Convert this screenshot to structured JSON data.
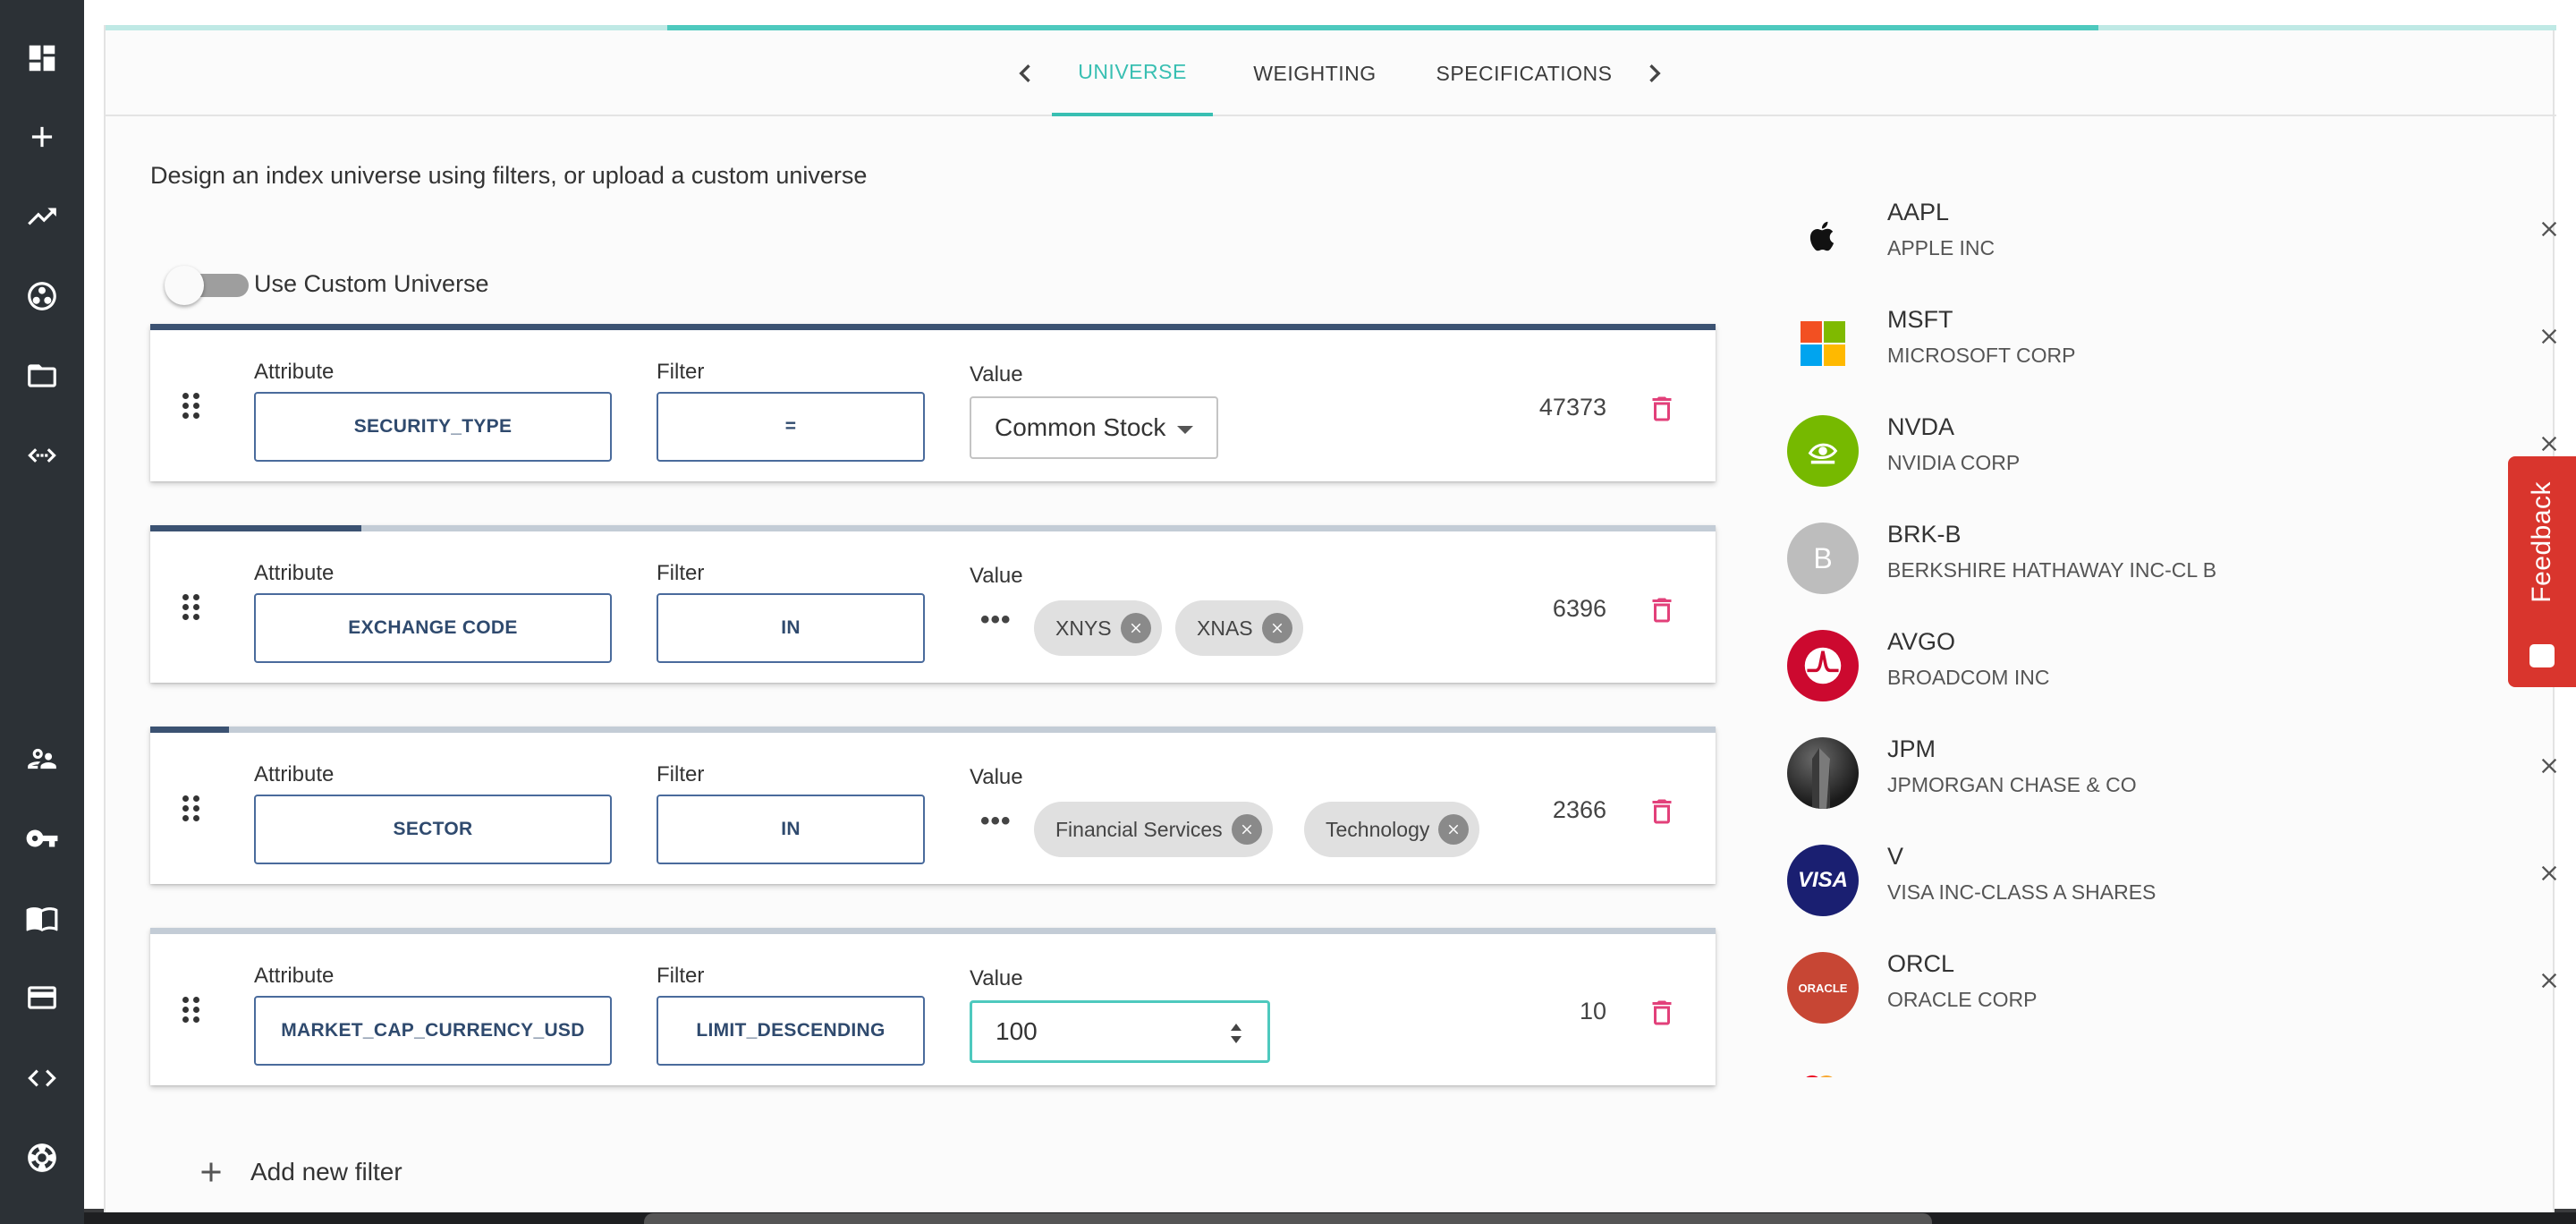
{
  "tabs": {
    "items": [
      {
        "label": "UNIVERSE",
        "active": true
      },
      {
        "label": "WEIGHTING",
        "active": false
      },
      {
        "label": "SPECIFICATIONS",
        "active": false
      }
    ]
  },
  "universe": {
    "intro": "Design an index universe using filters, or upload a custom universe",
    "toggle_label": "Use Custom Universe",
    "toggle_on": false,
    "add_filter_label": "Add new filter"
  },
  "labels": {
    "attribute": "Attribute",
    "filter": "Filter",
    "value": "Value",
    "ellipsis": "•••"
  },
  "filters": [
    {
      "attribute": "SECURITY_TYPE",
      "operator": "=",
      "value": "Common Stock",
      "count": "47373",
      "progress": 1.0
    },
    {
      "attribute": "EXCHANGE CODE",
      "operator": "IN",
      "chips": [
        "XNYS",
        "XNAS"
      ],
      "count": "6396",
      "progress": 0.135
    },
    {
      "attribute": "SECTOR",
      "operator": "IN",
      "chips": [
        "Financial Services",
        "Technology"
      ],
      "count": "2366",
      "progress": 0.05
    },
    {
      "attribute": "MARKET_CAP_CURRENCY_USD",
      "operator": "LIMIT_DESCENDING",
      "value": "100",
      "count": "10",
      "progress": 0.0
    }
  ],
  "stocks": [
    {
      "ticker": "AAPL",
      "name": "APPLE INC",
      "logo": "apple-logo"
    },
    {
      "ticker": "MSFT",
      "name": "MICROSOFT CORP",
      "logo": "microsoft-logo"
    },
    {
      "ticker": "NVDA",
      "name": "NVIDIA CORP",
      "logo": "nvidia-logo"
    },
    {
      "ticker": "BRK-B",
      "name": "BERKSHIRE HATHAWAY INC-CL B",
      "logo": "letter-avatar",
      "logo_letter": "B"
    },
    {
      "ticker": "AVGO",
      "name": "BROADCOM INC",
      "logo": "broadcom-logo"
    },
    {
      "ticker": "JPM",
      "name": "JPMORGAN CHASE & CO",
      "logo": "jpm-logo"
    },
    {
      "ticker": "V",
      "name": "VISA INC-CLASS A SHARES",
      "logo": "visa-logo",
      "logo_text": "VISA"
    },
    {
      "ticker": "ORCL",
      "name": "ORACLE CORP",
      "logo": "oracle-logo",
      "logo_text": "ORACLE"
    }
  ],
  "feedback": {
    "label": "Feedback"
  },
  "colors": {
    "accent": "#38bfb2",
    "card_border": "#3b5272",
    "delete": "#e2407a",
    "feedback": "#d9352d",
    "sidebar": "#2c3136"
  },
  "sidebar_icons": [
    "dashboard-icon",
    "add-icon",
    "trending-icon",
    "group-work-icon",
    "folder-icon",
    "api-icon",
    "users-icon",
    "key-icon",
    "book-icon",
    "credit-card-icon",
    "code-icon",
    "support-icon"
  ]
}
